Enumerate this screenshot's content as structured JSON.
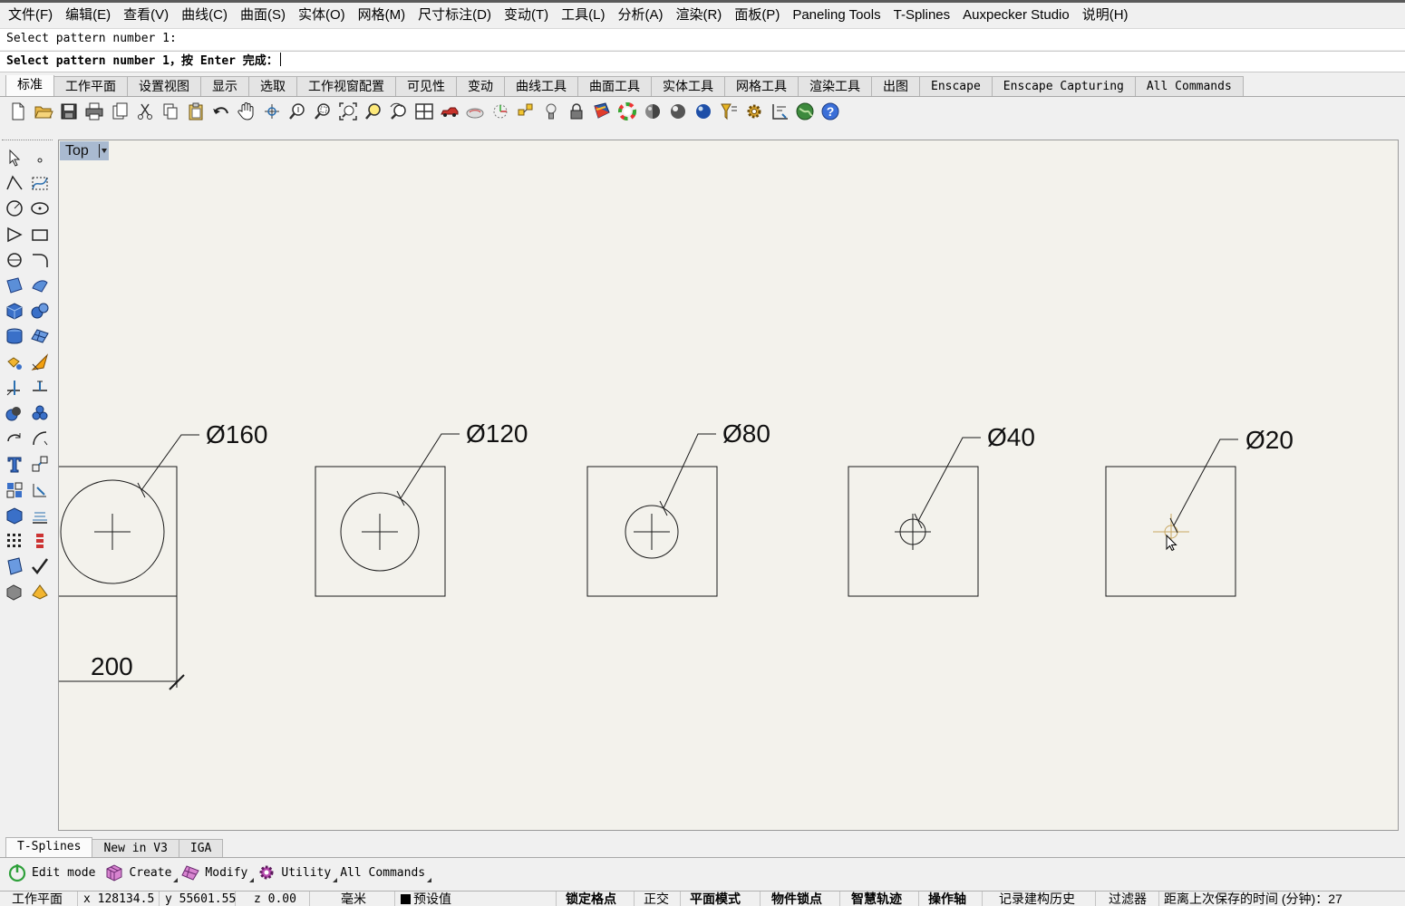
{
  "menu": [
    "文件(F)",
    "编辑(E)",
    "查看(V)",
    "曲线(C)",
    "曲面(S)",
    "实体(O)",
    "网格(M)",
    "尺寸标注(D)",
    "变动(T)",
    "工具(L)",
    "分析(A)",
    "渲染(R)",
    "面板(P)",
    "Paneling Tools",
    "T-Splines",
    "Auxpecker Studio",
    "说明(H)"
  ],
  "command": {
    "history": "Select pattern number 1:",
    "prompt": "Select pattern number 1，按 Enter 完成："
  },
  "tabs": [
    "标准",
    "工作平面",
    "设置视图",
    "显示",
    "选取",
    "工作视窗配置",
    "可见性",
    "变动",
    "曲线工具",
    "曲面工具",
    "实体工具",
    "网格工具",
    "渲染工具",
    "出图",
    "Enscape",
    "Enscape Capturing",
    "All Commands"
  ],
  "toolbar_icons": [
    "new-file-icon",
    "open-folder-icon",
    "save-icon",
    "print-icon",
    "export-icon",
    "cut-icon",
    "copy-icon",
    "paste-icon",
    "undo-icon",
    "pan-hand-icon",
    "rotate-view-icon",
    "zoom-icon",
    "zoom-window-icon",
    "zoom-extents-icon",
    "zoom-selected-icon",
    "undo-view-icon",
    "four-viewports-icon",
    "car-render-icon",
    "display-mode-icon",
    "cplane-icon",
    "snap-icon",
    "light-bulb-icon",
    "lock-icon",
    "material-icon",
    "color-wheel-icon",
    "shaded-sphere-icon",
    "rendered-sphere-icon",
    "render-sphere-icon",
    "filter-icon",
    "settings-gear-icon",
    "dimension-icon",
    "globe-icon",
    "help-icon"
  ],
  "viewport": {
    "label": "Top",
    "dimensions": {
      "d160": "Ø160",
      "d120": "Ø120",
      "d80": "Ø80",
      "d40": "Ø40",
      "d20": "Ø20",
      "width": "200"
    }
  },
  "bottom_tabs": [
    "T-Splines",
    "New in V3",
    "IGA"
  ],
  "tsplines_toolbar": [
    {
      "label": "Edit mode",
      "icon": "power-icon"
    },
    {
      "label": "Create",
      "icon": "create-cube-icon"
    },
    {
      "label": "Modify",
      "icon": "modify-icon"
    },
    {
      "label": "Utility",
      "icon": "utility-icon"
    },
    {
      "label": "All Commands",
      "icon": ""
    }
  ],
  "status": {
    "cplane": "工作平面",
    "x": "x 128134.5",
    "y": "y 55601.55",
    "z": "z 0.00",
    "units": "毫米",
    "layer": "预设值",
    "grid_snap": "锁定格点",
    "ortho": "正交",
    "planar": "平面模式",
    "osnap": "物件锁点",
    "smarttrack": "智慧轨迹",
    "gumball": "操作轴",
    "history": "记录建构历史",
    "filter": "过滤器",
    "last_save": "距离上次保存的时间 (分钟)：27"
  },
  "colors": {
    "viewport_bg": "#f3f2ec",
    "viewport_label_bg": "#a9bad0",
    "ui_bg": "#f0f0f0"
  }
}
